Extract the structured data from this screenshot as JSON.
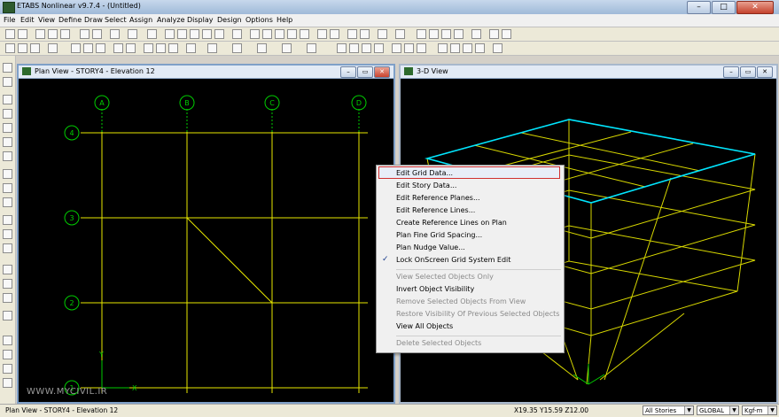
{
  "app": {
    "title": "ETABS Nonlinear v9.7.4 - (Untitled)"
  },
  "window_buttons": {
    "minimize": "–",
    "maximize": "□",
    "close": "✕"
  },
  "menu": [
    "File",
    "Edit",
    "View",
    "Define",
    "Draw",
    "Select",
    "Assign",
    "Analyze",
    "Display",
    "Design",
    "Options",
    "Help"
  ],
  "plan_view": {
    "title": "Plan View - STORY4 - Elevation 12",
    "columns": [
      "A",
      "B",
      "C",
      "D"
    ],
    "rows": [
      "4",
      "3",
      "2",
      "1"
    ],
    "axis_x_label": "X",
    "axis_y_label": "Y",
    "watermark": "WWW.MYCIVIL.IR",
    "grid_color": "#e8e800",
    "bubble_color": "#00cc00"
  },
  "view_3d": {
    "title": "3-D View",
    "frame_color": "#d8d800",
    "highlight_color": "#00e5ff"
  },
  "mdi_buttons": {
    "minimize": "–",
    "restore": "▭",
    "close": "✕"
  },
  "context_menu": {
    "items": [
      {
        "label": "Edit Grid Data...",
        "state": "highlighted"
      },
      {
        "label": "Edit Story Data...",
        "state": "enabled"
      },
      {
        "label": "Edit Reference Planes...",
        "state": "enabled"
      },
      {
        "label": "Edit Reference Lines...",
        "state": "enabled"
      },
      {
        "label": "Create Reference Lines on Plan",
        "state": "enabled"
      },
      {
        "label": "Plan Fine Grid Spacing...",
        "state": "enabled"
      },
      {
        "label": "Plan Nudge Value...",
        "state": "enabled"
      },
      {
        "label": "Lock OnScreen Grid System Edit",
        "state": "checked"
      },
      {
        "label": "View Selected Objects Only",
        "state": "disabled"
      },
      {
        "label": "Invert Object Visibility",
        "state": "enabled"
      },
      {
        "label": "Remove Selected Objects From View",
        "state": "disabled"
      },
      {
        "label": "Restore Visibility Of Previous Selected Objects",
        "state": "disabled"
      },
      {
        "label": "View All Objects",
        "state": "enabled"
      },
      {
        "label": "Delete Selected Objects",
        "state": "disabled"
      }
    ]
  },
  "status": {
    "left_text": "Plan View - STORY4 - Elevation 12",
    "coords": "X19.35  Y15.59  Z12.00",
    "story_select": "All Stories",
    "coord_system": "GLOBAL",
    "units": "Kgf-m"
  }
}
